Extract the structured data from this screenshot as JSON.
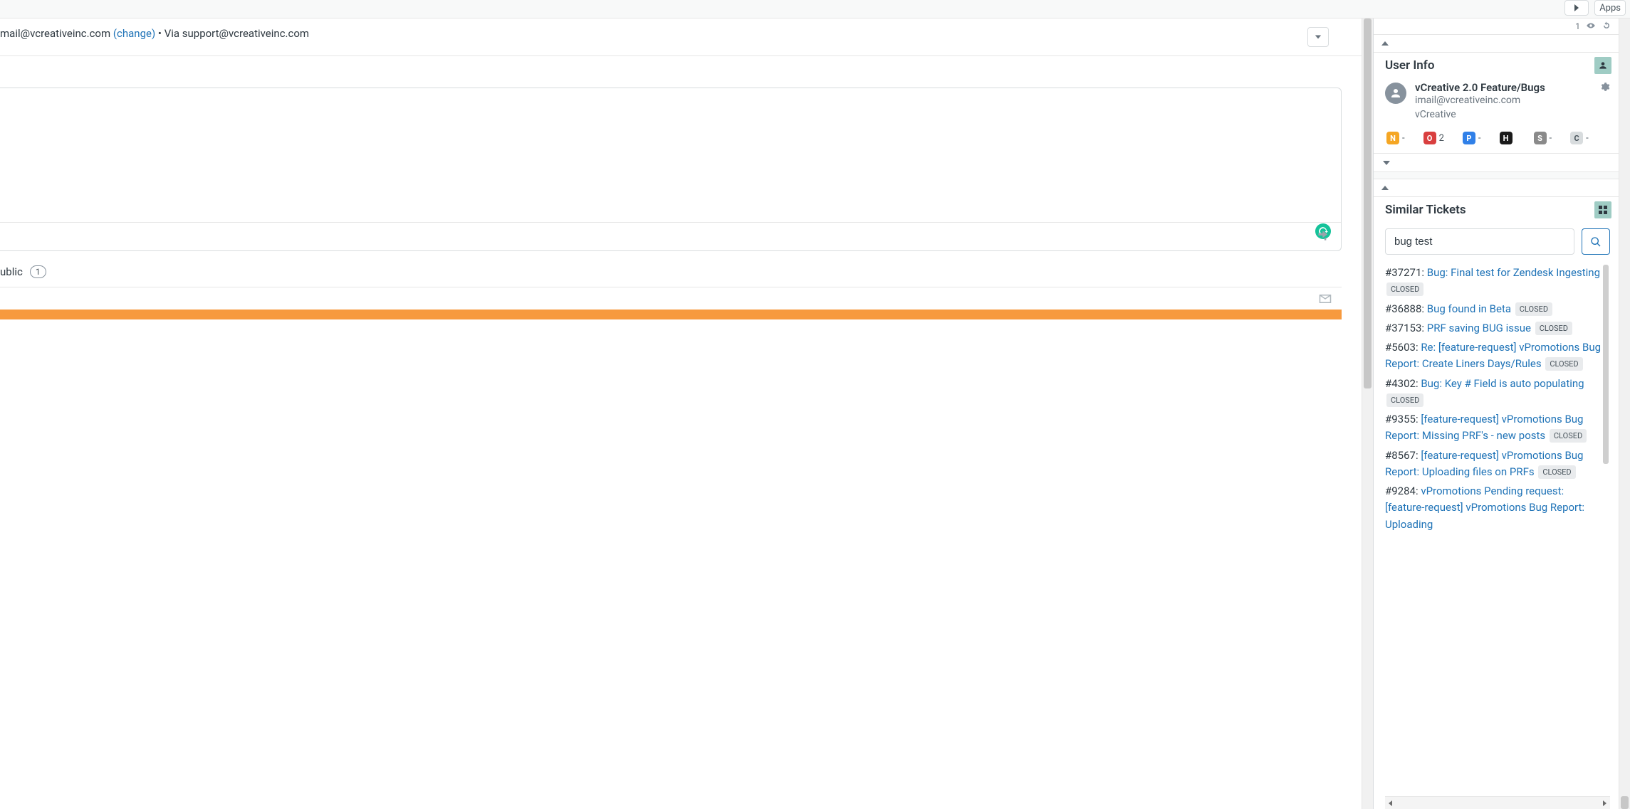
{
  "topbar": {
    "apps_label": "Apps"
  },
  "email": {
    "from": "mail@vcreativeinc.com",
    "change_label": "(change)",
    "via": " • Via support@vcreativeinc.com"
  },
  "conversation": {
    "label": "ublic",
    "count": "1"
  },
  "sidebar": {
    "viewers": "1",
    "user_info": {
      "title": "User Info",
      "name": "vCreative 2.0 Feature/Bugs",
      "email": "imail@vcreativeinc.com",
      "org": "vCreative",
      "chips": {
        "n": {
          "letter": "N",
          "value": "-"
        },
        "o": {
          "letter": "O",
          "value": "2"
        },
        "p": {
          "letter": "P",
          "value": "-"
        },
        "h": {
          "letter": "H",
          "value": ""
        },
        "s": {
          "letter": "S",
          "value": "-"
        },
        "c": {
          "letter": "C",
          "value": "-"
        }
      }
    },
    "similar": {
      "title": "Similar Tickets",
      "search_value": "bug test",
      "status_closed": "CLOSED",
      "results": [
        {
          "id": "#37271",
          "title": "Bug: Final test for Zendesk Ingesting",
          "status": "CLOSED"
        },
        {
          "id": "#36888",
          "title": "Bug found in Beta",
          "status": "CLOSED"
        },
        {
          "id": "#37153",
          "title": "PRF saving BUG issue",
          "status": "CLOSED"
        },
        {
          "id": "#5603",
          "title": "Re: [feature-request] vPromotions Bug Report: Create Liners Days/Rules",
          "status": "CLOSED"
        },
        {
          "id": "#4302",
          "title": "Bug: Key # Field is auto populating",
          "status": "CLOSED"
        },
        {
          "id": "#9355",
          "title": "[feature-request] vPromotions Bug Report: Missing PRF's - new posts",
          "status": "CLOSED"
        },
        {
          "id": "#8567",
          "title": "[feature-request] vPromotions Bug Report: Uploading files on PRFs",
          "status": "CLOSED"
        },
        {
          "id": "#9284",
          "title": "vPromotions Pending request: [feature-request] vPromotions Bug Report: Uploading",
          "status": ""
        }
      ]
    }
  }
}
